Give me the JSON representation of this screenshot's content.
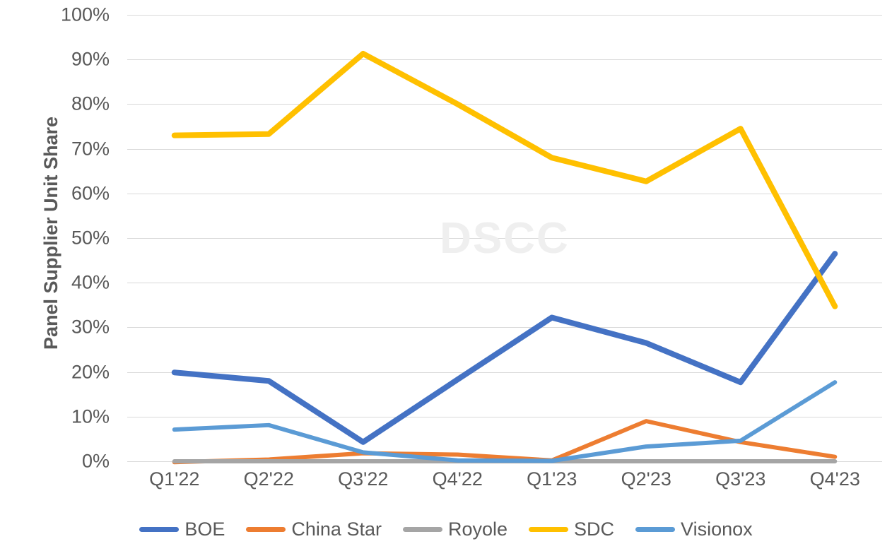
{
  "chart_data": {
    "type": "line",
    "title": "",
    "subtitle": "",
    "xlabel": "",
    "ylabel": "Panel Supplier Unit Share",
    "categories": [
      "Q1'22",
      "Q2'22",
      "Q3'22",
      "Q4'22",
      "Q1'23",
      "Q2'23",
      "Q3'23",
      "Q4'23"
    ],
    "ylim": [
      0,
      100
    ],
    "y_ticks": [
      "0%",
      "10%",
      "20%",
      "30%",
      "40%",
      "50%",
      "60%",
      "70%",
      "80%",
      "90%",
      "100%"
    ],
    "y_tick_values": [
      0,
      10,
      20,
      30,
      40,
      50,
      60,
      70,
      80,
      90,
      100
    ],
    "grid": true,
    "legend_position": "bottom",
    "watermark": "DSCC",
    "series": [
      {
        "name": "BOE",
        "color": "#4472c4",
        "values": [
          19.9,
          18.0,
          4.3,
          18.3,
          32.2,
          26.5,
          17.7,
          46.5
        ]
      },
      {
        "name": "China Star",
        "color": "#ed7d31",
        "values": [
          -0.2,
          0.4,
          1.8,
          1.5,
          0.2,
          9.0,
          4.3,
          1.0
        ]
      },
      {
        "name": "Royole",
        "color": "#a5a5a5",
        "values": [
          0.0,
          0.0,
          0.0,
          0.0,
          0.0,
          0.0,
          0.0,
          0.0
        ]
      },
      {
        "name": "SDC",
        "color": "#ffc000",
        "values": [
          73.0,
          73.3,
          91.3,
          80.0,
          68.0,
          62.7,
          74.5,
          34.7
        ]
      },
      {
        "name": "Visionox",
        "color": "#5b9bd5",
        "values": [
          7.1,
          8.1,
          2.0,
          0.2,
          0.1,
          3.3,
          4.6,
          17.7
        ]
      }
    ]
  },
  "legend": {
    "items": [
      {
        "label": "BOE"
      },
      {
        "label": "China Star"
      },
      {
        "label": "Royole"
      },
      {
        "label": "SDC"
      },
      {
        "label": "Visionox"
      }
    ]
  },
  "colors": {
    "boe": "#4472c4",
    "china_star": "#ed7d31",
    "royole": "#a5a5a5",
    "sdc": "#ffc000",
    "visionox": "#5b9bd5",
    "gridline": "#d9d9d9",
    "text": "#595959",
    "watermark": "#efefef",
    "background": "#ffffff"
  }
}
